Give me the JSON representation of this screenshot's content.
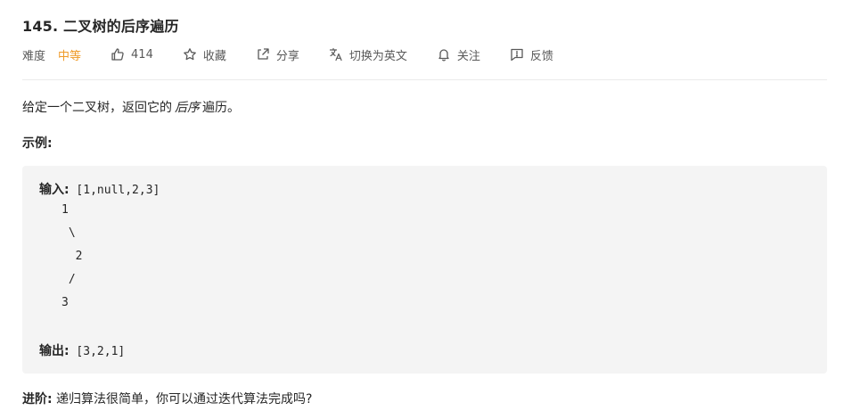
{
  "problem": {
    "title": "145. 二叉树的后序遍历"
  },
  "meta": {
    "difficulty_label": "难度",
    "difficulty_value": "中等",
    "likes": "414",
    "favorite": "收藏",
    "share": "分享",
    "translate": "切换为英文",
    "follow": "关注",
    "feedback": "反馈",
    "icons": [
      "thumbs-up-icon",
      "star-icon",
      "share-icon",
      "translate-icon",
      "bell-icon",
      "feedback-icon"
    ],
    "difficulty_color": "#ef9a27"
  },
  "description": {
    "prefix": "给定一个二叉树，返回它的",
    "emphasis": "后序",
    "suffix": "遍历。"
  },
  "example": {
    "title": "示例:",
    "input_label": "输入:",
    "input_value": " [1,null,2,3]",
    "tree_lines": [
      "1",
      " \\",
      "  2",
      " /",
      "3"
    ],
    "output_label": "输出:",
    "output_value": " [3,2,1]"
  },
  "followup": {
    "label": "进阶:",
    "text": " 递归算法很简单，你可以通过迭代算法完成吗?"
  }
}
